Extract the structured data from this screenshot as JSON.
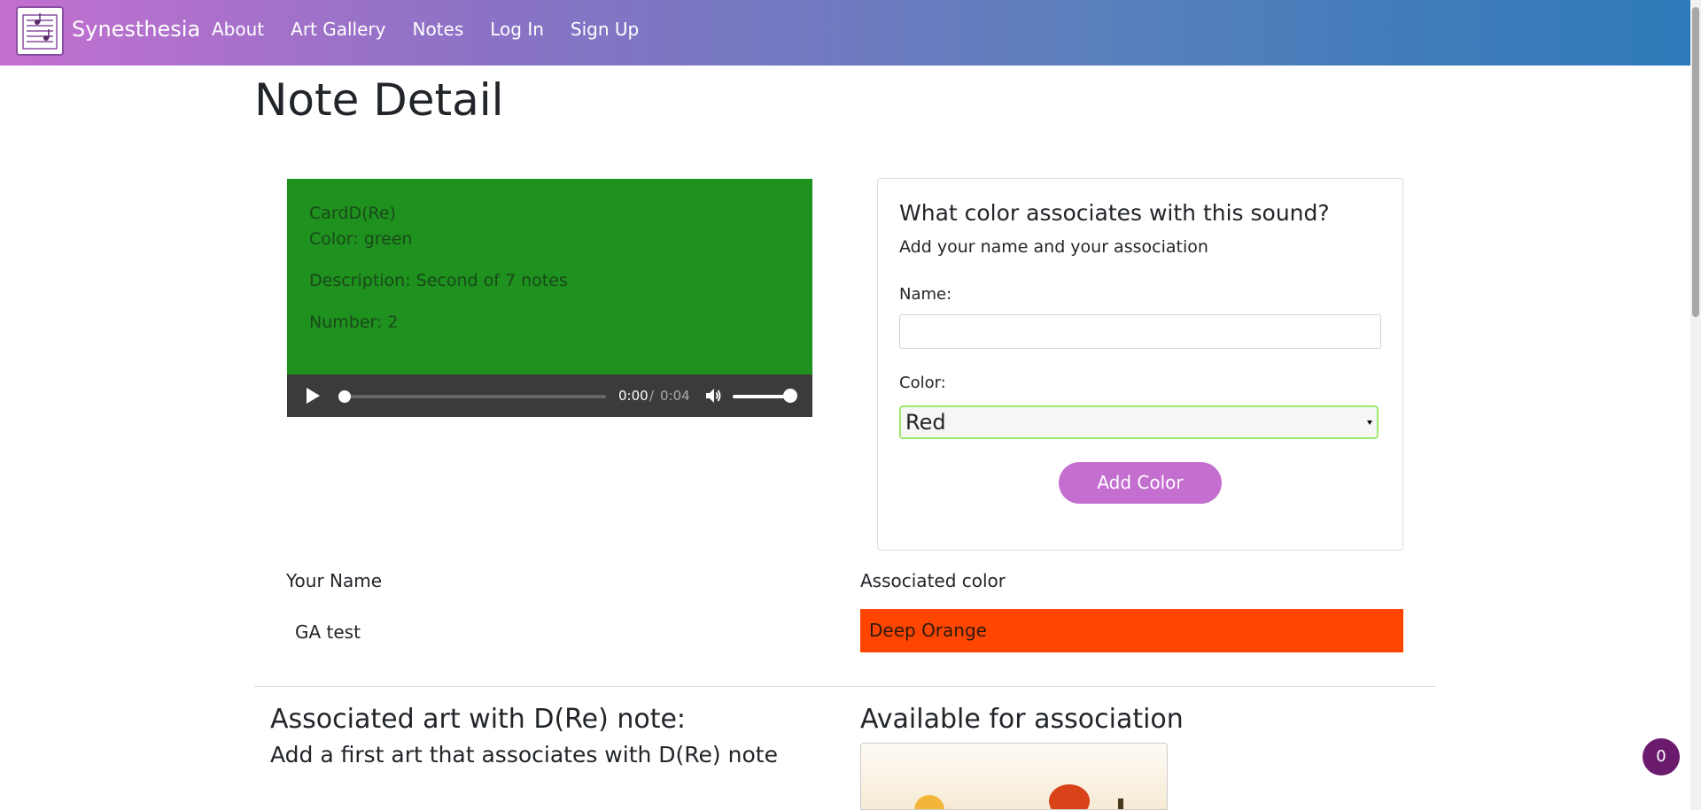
{
  "navbar": {
    "brand": "Synesthesia",
    "links": [
      "About",
      "Art Gallery",
      "Notes",
      "Log In",
      "Sign Up"
    ],
    "logo_icon": "music-notes-logo-icon"
  },
  "page": {
    "title": "Note Detail"
  },
  "note_card": {
    "name": "CardD(Re)",
    "color_line": "Color: green",
    "description": "Description: Second of 7 notes",
    "number": "Number: 2",
    "background": "#1e911e"
  },
  "audio": {
    "current_time": "0:00",
    "separator": "/",
    "duration": "0:04",
    "progress": 0,
    "volume": 1.0
  },
  "association_form": {
    "heading": "What color associates with this sound?",
    "subheading": "Add your name and your association",
    "name_label": "Name:",
    "name_value": "",
    "color_label": "Color:",
    "color_selected": "Red",
    "submit_label": "Add Color",
    "accent": "#c46fd0"
  },
  "associations_table": {
    "headers": [
      "Your Name",
      "Associated color"
    ],
    "rows": [
      {
        "name": "GA test",
        "color": "Deep Orange",
        "swatch": "#ff4500"
      }
    ]
  },
  "art_section": {
    "heading": "Associated art with D(Re) note:",
    "subheading": "Add a first art that associates with D(Re) note"
  },
  "available_section": {
    "heading": "Available for association"
  },
  "badge": {
    "count": "0"
  }
}
